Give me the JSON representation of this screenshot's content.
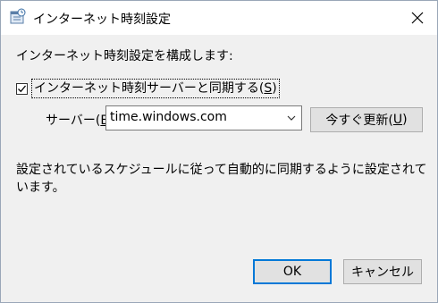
{
  "window": {
    "title": "インターネット時刻設定"
  },
  "heading": "インターネット時刻設定を構成します:",
  "sync_checkbox": {
    "label": "インターネット時刻サーバーと同期する(",
    "accel": "S",
    "close": ")",
    "checked": true
  },
  "server": {
    "label": "サーバー(",
    "accel": "E",
    "label_end": "):",
    "value": "time.windows.com"
  },
  "update_button": {
    "label": "今すぐ更新(",
    "accel": "U",
    "close": ")"
  },
  "info": "設定されているスケジュールに従って自動的に同期するように設定されています。",
  "buttons": {
    "ok": "OK",
    "cancel": "キャンセル"
  },
  "icons": {
    "title": "clock-calendar-icon",
    "close": "close-icon",
    "check": "checkmark-icon",
    "dropdown": "chevron-down-icon"
  },
  "colors": {
    "accent": "#0078d7",
    "button_face": "#e1e1e1"
  }
}
